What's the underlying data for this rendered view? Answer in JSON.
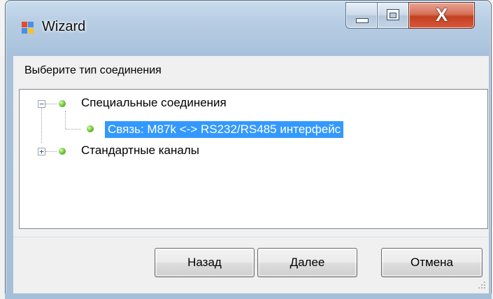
{
  "window": {
    "title": "Wizard",
    "icon": "application-window-icon",
    "controls": {
      "minimize_icon": "minimize-icon",
      "maximize_icon": "maximize-icon",
      "close_glyph": "X"
    }
  },
  "main": {
    "prompt": "Выберите тип соединения",
    "tree": {
      "nodes": [
        {
          "label": "Специальные соединения",
          "expanded": true,
          "expander": "⊟",
          "children": [
            {
              "label": "Связь: M87k <-> RS232/RS485 интерфейс",
              "selected": true
            }
          ]
        },
        {
          "label": "Стандартные каналы",
          "expanded": false,
          "expander": "⊞"
        }
      ]
    }
  },
  "buttons": {
    "back": "Назад",
    "next": "Далее",
    "cancel": "Отмена"
  },
  "colors": {
    "selection": "#3399ff",
    "frame": "#b7cde3",
    "close_button": "#c3401f",
    "node_dot": "#7ac943"
  }
}
